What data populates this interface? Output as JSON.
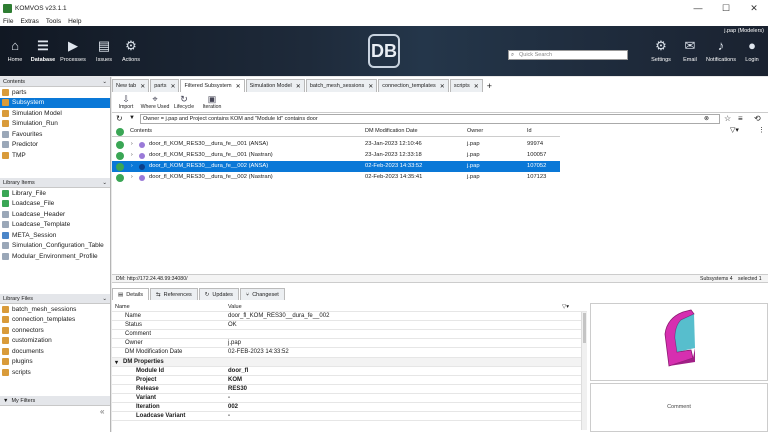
{
  "window": {
    "title": "KOMVOS v23.1.1",
    "controls": [
      "—",
      "☐",
      "✕"
    ]
  },
  "menu": [
    "File",
    "Extras",
    "Tools",
    "Help"
  ],
  "banner": {
    "tools_left": [
      {
        "label": "Home",
        "icon": "⌂"
      },
      {
        "label": "Database",
        "icon": "☰"
      },
      {
        "label": "Processes",
        "icon": "▶"
      },
      {
        "label": "Issues",
        "icon": "▤"
      },
      {
        "label": "Actions",
        "icon": "⚙"
      }
    ],
    "logo": "DB",
    "search_placeholder": "Quick Search",
    "user": "j.pap (Modelers)",
    "tools_right": [
      {
        "label": "Settings",
        "icon": "⚙"
      },
      {
        "label": "Email",
        "icon": "✉"
      },
      {
        "label": "Notifications",
        "icon": "♪"
      },
      {
        "label": "Login",
        "icon": "●"
      }
    ]
  },
  "contents": {
    "title": "Contents",
    "items": [
      "parts",
      "Subsystem",
      "Simulation Model",
      "Simulation_Run",
      "Favourites",
      "Predictor",
      "TMP"
    ],
    "selected": 1
  },
  "library_items": {
    "title": "Library Items",
    "items": [
      "Library_File",
      "Loadcase_File",
      "Loadcase_Header",
      "Loadcase_Template",
      "META_Session",
      "Simulation_Configuration_Table",
      "Modular_Environment_Profile"
    ]
  },
  "library_files": {
    "title": "Library Files",
    "items": [
      "batch_mesh_sessions",
      "connection_templates",
      "connectors",
      "customization",
      "documents",
      "plugins",
      "scripts"
    ]
  },
  "my_filters": "My Filters",
  "tabs": [
    "New tab",
    "parts",
    "Filtered Subsystem",
    "Simulation Model",
    "batch_mesh_sessions",
    "connection_templates",
    "scripts"
  ],
  "active_tab": 2,
  "toolbar": [
    {
      "label": "Import",
      "icon": "⇩"
    },
    {
      "label": "Where Used",
      "icon": "⌖"
    },
    {
      "label": "Lifecycle",
      "icon": "↻"
    },
    {
      "label": "Iteration",
      "icon": "▣"
    }
  ],
  "query": "Owner = j.pap and Project contains KOM and \"Module Id\" contains door",
  "grid": {
    "columns": [
      "Contents",
      "DM Modification Date",
      "Owner",
      "Id"
    ],
    "rows": [
      {
        "name": "door_fl_KOM_RES30__dura_fe__001 (ANSA)",
        "date": "23-Jan-2023 12:10:46",
        "owner": "j.pap",
        "id": "99974"
      },
      {
        "name": "door_fl_KOM_RES30__dura_fe__001 (Nastran)",
        "date": "23-Jan-2023 12:33:18",
        "owner": "j.pap",
        "id": "100057"
      },
      {
        "name": "door_fl_KOM_RES30__dura_fe__002 (ANSA)",
        "date": "02-Feb-2023 14:33:52",
        "owner": "j.pap",
        "id": "107052"
      },
      {
        "name": "door_fl_KOM_RES30__dura_fe__002 (Nastran)",
        "date": "02-Feb-2023 14:35:41",
        "owner": "j.pap",
        "id": "107123"
      }
    ],
    "selected": 2
  },
  "status": {
    "dm": "DM: http://172.24.48.99:34080/",
    "count": "Subsystems 4",
    "selected": "selected 1"
  },
  "bottom_tabs": [
    "Details",
    "References",
    "Updates",
    "Changeset"
  ],
  "details": {
    "headers": [
      "Name",
      "Value"
    ],
    "rows": [
      {
        "k": "Name",
        "v": "door_fl_KOM_RES30__dura_fe__002"
      },
      {
        "k": "Status",
        "v": "OK"
      },
      {
        "k": "Comment",
        "v": ""
      },
      {
        "k": "Owner",
        "v": "j.pap"
      },
      {
        "k": "DM Modification Date",
        "v": "02-FEB-2023 14:33:52"
      }
    ],
    "group": "DM Properties",
    "dm_rows": [
      {
        "k": "Module Id",
        "v": "door_fl"
      },
      {
        "k": "Project",
        "v": "KOM"
      },
      {
        "k": "Release",
        "v": "RES30"
      },
      {
        "k": "Variant",
        "v": "-"
      },
      {
        "k": "Iteration",
        "v": "002"
      },
      {
        "k": "Loadcase Variant",
        "v": "-"
      }
    ]
  },
  "comment_label": "Comment",
  "colors": {
    "accent": "#0a78d7",
    "status_ok": "#3aa655",
    "part": "#d62fb0"
  }
}
